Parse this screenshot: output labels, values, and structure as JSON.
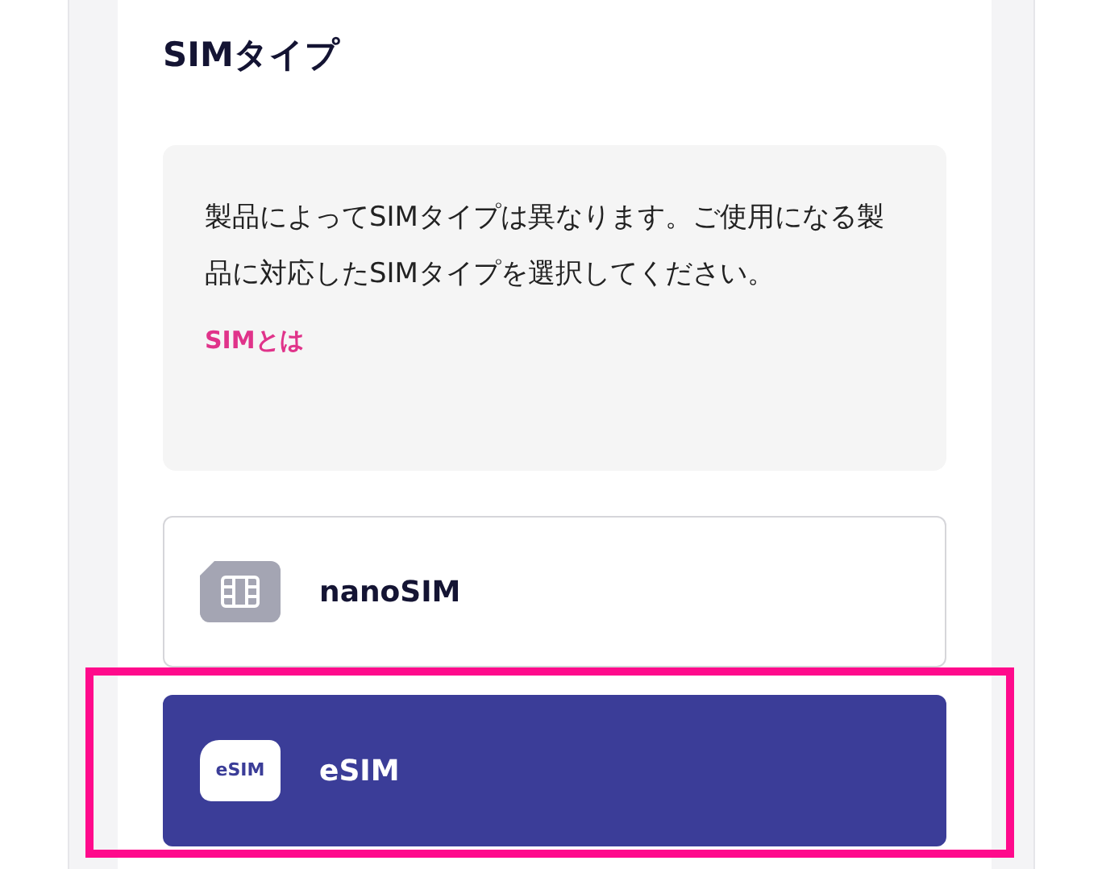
{
  "title": "SIMタイプ",
  "info": {
    "text": "製品によってSIMタイプは異なります。ご使用になる製品に対応したSIMタイプを選択してください。",
    "link": "SIMとは"
  },
  "options": [
    {
      "kind": "nanosim",
      "label": "nanoSIM",
      "selected": false,
      "highlighted": false
    },
    {
      "kind": "esim",
      "label": "eSIM",
      "icon_text": "eSIM",
      "selected": true,
      "highlighted": true
    }
  ]
}
